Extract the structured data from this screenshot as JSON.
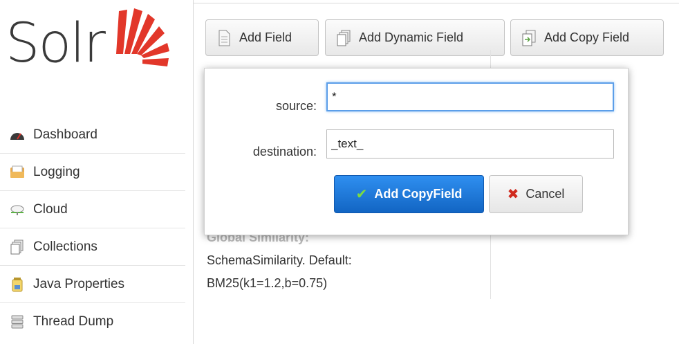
{
  "logo": {
    "text": "Solr"
  },
  "nav": {
    "items": [
      {
        "label": "Dashboard",
        "icon": "dashboard-icon"
      },
      {
        "label": "Logging",
        "icon": "logging-icon"
      },
      {
        "label": "Cloud",
        "icon": "cloud-icon"
      },
      {
        "label": "Collections",
        "icon": "collections-icon"
      },
      {
        "label": "Java Properties",
        "icon": "java-properties-icon"
      },
      {
        "label": "Thread Dump",
        "icon": "thread-dump-icon"
      }
    ]
  },
  "toolbar": {
    "add_field": "Add Field",
    "add_dynamic_field": "Add Dynamic Field",
    "add_copy_field": "Add Copy Field"
  },
  "schema_info": {
    "similarity_heading": "Global Similarity:",
    "similarity_line1": "SchemaSimilarity. Default:",
    "similarity_line2": "BM25(k1=1.2,b=0.75)"
  },
  "dialog": {
    "source_label": "source:",
    "source_value": "*",
    "destination_label": "destination:",
    "destination_value": "_text_",
    "submit_label": "Add CopyField",
    "cancel_label": "Cancel"
  },
  "colors": {
    "primary_button": "#1b76d9",
    "focus_ring": "#5b9ee9",
    "logo_red": "#e2372a",
    "check_green": "#7ddc3f",
    "cancel_red": "#d02a1e"
  }
}
